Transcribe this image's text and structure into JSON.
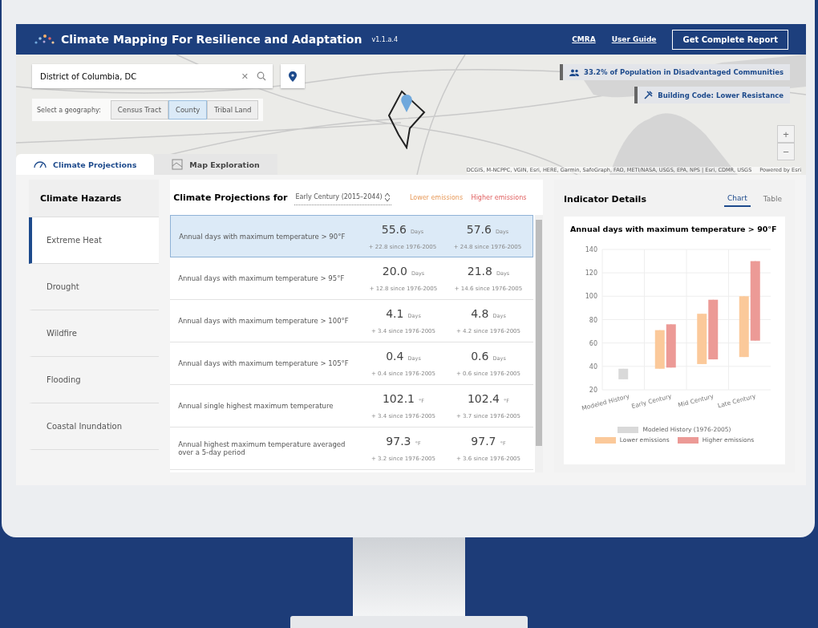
{
  "header": {
    "title": "Climate Mapping For Resilience and Adaptation",
    "version": "v1.1.a.4",
    "links": [
      "CMRA",
      "User Guide"
    ],
    "report_button": "Get Complete Report"
  },
  "map": {
    "search": {
      "value": "District of Columbia, DC",
      "clear": "✕"
    },
    "geography_label": "Select a geography:",
    "geographies": [
      {
        "label": "Census Tract",
        "selected": false
      },
      {
        "label": "County",
        "selected": true
      },
      {
        "label": "Tribal Land",
        "selected": false
      }
    ],
    "badges": [
      {
        "kind": "people",
        "label": "33.2% of Population in Disadvantaged Communities"
      },
      {
        "kind": "tools",
        "label": "Building Code: Lower Resistance"
      }
    ],
    "zoom": [
      "+",
      "−"
    ],
    "attribution": "DCGIS, M-NCPPC, VGIN, Esri, HERE, Garmin, SafeGraph, FAO, METI/NASA, USGS, EPA, NPS | Esri, CDMR, USGS",
    "powered": "Powered by Esri"
  },
  "tabs": [
    {
      "kind": "gauge",
      "label": "Climate Projections",
      "selected": true
    },
    {
      "kind": "map",
      "label": "Map Exploration",
      "selected": false
    }
  ],
  "hazards": {
    "title": "Climate Hazards",
    "items": [
      {
        "label": "Extreme Heat",
        "selected": true
      },
      {
        "label": "Drought",
        "selected": false
      },
      {
        "label": "Wildfire",
        "selected": false
      },
      {
        "label": "Flooding",
        "selected": false
      },
      {
        "label": "Coastal Inundation",
        "selected": false
      }
    ]
  },
  "projections": {
    "title": "Climate Projections for",
    "period": "Early Century (2015–2044)",
    "columns": [
      "Lower emissions",
      "Higher emissions"
    ],
    "rows": [
      {
        "label": "Annual days with maximum temperature > 90°F",
        "selected": true,
        "lower": {
          "value": "55.6",
          "unit": "Days",
          "change": "+ 22.8 since 1976-2005"
        },
        "higher": {
          "value": "57.6",
          "unit": "Days",
          "change": "+ 24.8 since 1976-2005"
        }
      },
      {
        "label": "Annual days with maximum temperature > 95°F",
        "selected": false,
        "lower": {
          "value": "20.0",
          "unit": "Days",
          "change": "+ 12.8 since 1976-2005"
        },
        "higher": {
          "value": "21.8",
          "unit": "Days",
          "change": "+ 14.6 since 1976-2005"
        }
      },
      {
        "label": "Annual days with maximum temperature > 100°F",
        "selected": false,
        "lower": {
          "value": "4.1",
          "unit": "Days",
          "change": "+ 3.4 since 1976-2005"
        },
        "higher": {
          "value": "4.8",
          "unit": "Days",
          "change": "+ 4.2 since 1976-2005"
        }
      },
      {
        "label": "Annual days with maximum temperature > 105°F",
        "selected": false,
        "lower": {
          "value": "0.4",
          "unit": "Days",
          "change": "+ 0.4 since 1976-2005"
        },
        "higher": {
          "value": "0.6",
          "unit": "Days",
          "change": "+ 0.6 since 1976-2005"
        }
      },
      {
        "label": "Annual single highest maximum temperature",
        "selected": false,
        "lower": {
          "value": "102.1",
          "unit": "°F",
          "change": "+ 3.4 since 1976-2005"
        },
        "higher": {
          "value": "102.4",
          "unit": "°F",
          "change": "+ 3.7 since 1976-2005"
        }
      },
      {
        "label": "Annual highest maximum temperature averaged over a 5-day period",
        "selected": false,
        "lower": {
          "value": "97.3",
          "unit": "°F",
          "change": "+ 3.2 since 1976-2005"
        },
        "higher": {
          "value": "97.7",
          "unit": "°F",
          "change": "+ 3.6 since 1976-2005"
        }
      }
    ]
  },
  "details": {
    "title": "Indicator Details",
    "tabs": [
      {
        "label": "Chart",
        "selected": true
      },
      {
        "label": "Table",
        "selected": false
      }
    ],
    "chart_data": {
      "type": "candlestick",
      "grid": true,
      "title": "Annual days with maximum temperature > 90°F",
      "categories": [
        "Modeled History",
        "Early Century",
        "Mid Century",
        "Late Century"
      ],
      "ylim": [
        20,
        140
      ],
      "yticks": [
        20,
        40,
        60,
        80,
        100,
        120,
        140
      ],
      "series": [
        {
          "name": "Modeled History (1976-2005)",
          "color": "#d9d9d9",
          "ohlc": [
            [
              29,
              38,
              29,
              38
            ],
            null,
            null,
            null
          ]
        },
        {
          "name": "Lower emissions",
          "color": "#fbc99a",
          "ohlc": [
            null,
            [
              38,
              71,
              38,
              71
            ],
            [
              42,
              85,
              42,
              85
            ],
            [
              48,
              100,
              48,
              100
            ]
          ]
        },
        {
          "name": "Higher emissions",
          "color": "#ec9a96",
          "ohlc": [
            null,
            [
              39,
              76,
              39,
              76
            ],
            [
              46,
              97,
              46,
              97
            ],
            [
              62,
              130,
              62,
              130
            ]
          ]
        }
      ]
    }
  }
}
